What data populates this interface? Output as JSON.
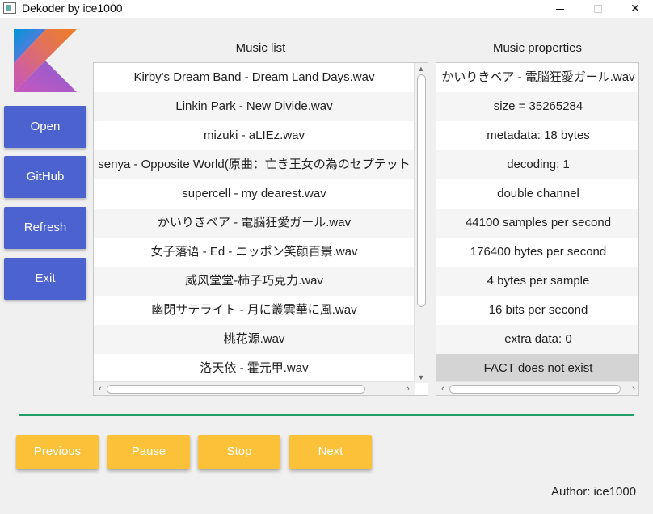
{
  "window": {
    "title": "Dekoder by ice1000",
    "minimize": "",
    "maximize": "",
    "close": "✕"
  },
  "sidebar": {
    "buttons": [
      {
        "label": "Open"
      },
      {
        "label": "GitHub"
      },
      {
        "label": "Refresh"
      },
      {
        "label": "Exit"
      }
    ]
  },
  "music_list": {
    "title": "Music list",
    "items": [
      "Kirby's Dream Band - Dream Land Days.wav",
      "Linkin Park - New Divide.wav",
      "mizuki - aLIEz.wav",
      "senya - Opposite World(原曲：亡き王女の為のセプテット",
      "supercell - my dearest.wav",
      "かいりきベア - 電脳狂愛ガール.wav",
      "女子落语 - Ed - ニッポン笑颜百景.wav",
      "威风堂堂-柿子巧克力.wav",
      "幽閉サテライト - 月に叢雲華に風.wav",
      "桃花源.wav",
      "洛天依 - 霍元甲.wav"
    ]
  },
  "music_properties": {
    "title": "Music properties",
    "items": [
      "かいりきベア - 電脳狂愛ガール.wav",
      "size = 35265284",
      "metadata: 18 bytes",
      "decoding: 1",
      "double channel",
      "44100 samples per second",
      "176400 bytes per second",
      "4 bytes per sample",
      "16 bits per second",
      "extra data: 0",
      "FACT does not exist"
    ],
    "selected_index": 10
  },
  "controls": {
    "previous": "Previous",
    "pause": "Pause",
    "stop": "Stop",
    "next": "Next"
  },
  "footer": {
    "author": "Author: ice1000"
  },
  "colors": {
    "side_button": "#4c63cf",
    "control_button": "#fbc139",
    "divider": "#1f9e68"
  }
}
